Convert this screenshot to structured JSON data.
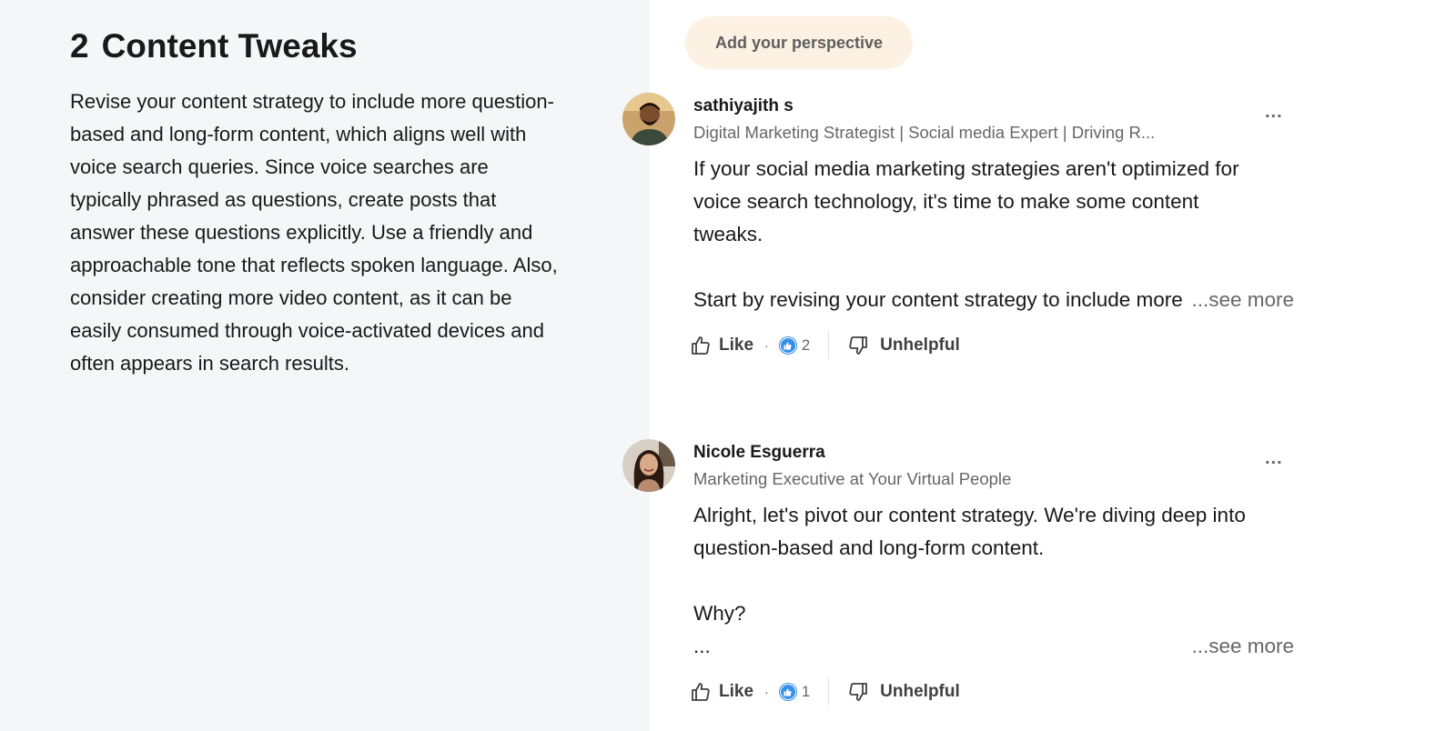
{
  "article": {
    "section_number": "2",
    "section_title": "Content Tweaks",
    "section_body": "Revise your content strategy to include more question-based and long-form content, which aligns well with voice search queries. Since voice searches are typically phrased as questions, create posts that answer these questions explicitly. Use a friendly and approachable tone that reflects spoken language. Also, consider creating more video content, as it can be easily consumed through voice-activated devices and often appears in search results."
  },
  "add_perspective_label": "Add your perspective",
  "contributions": [
    {
      "author": "sathiyajith s",
      "headline": "Digital Marketing Strategist | Social media Expert | Driving R...",
      "text_lines": [
        "If your social media marketing strategies aren't optimized for",
        "voice search technology, it's time to make some content",
        "tweaks."
      ],
      "last_line": "Start by revising your content strategy to include more",
      "see_more": "...see more",
      "like_label": "Like",
      "reaction_count": "2",
      "unhelpful_label": "Unhelpful",
      "more_menu": "..."
    },
    {
      "author": "Nicole Esguerra",
      "headline": "Marketing Executive at Your Virtual People",
      "text_lines": [
        "Alright, let's pivot our content strategy. We're diving deep into",
        "question-based and long-form content."
      ],
      "extra_line": "Why?",
      "last_line": "...",
      "see_more": "...see more",
      "like_label": "Like",
      "reaction_count": "1",
      "unhelpful_label": "Unhelpful",
      "more_menu": "..."
    }
  ],
  "colors": {
    "left_panel_bg": "#f4f6f8",
    "add_button_bg": "#fcf1e3",
    "reaction_blue": "#378fe9"
  }
}
